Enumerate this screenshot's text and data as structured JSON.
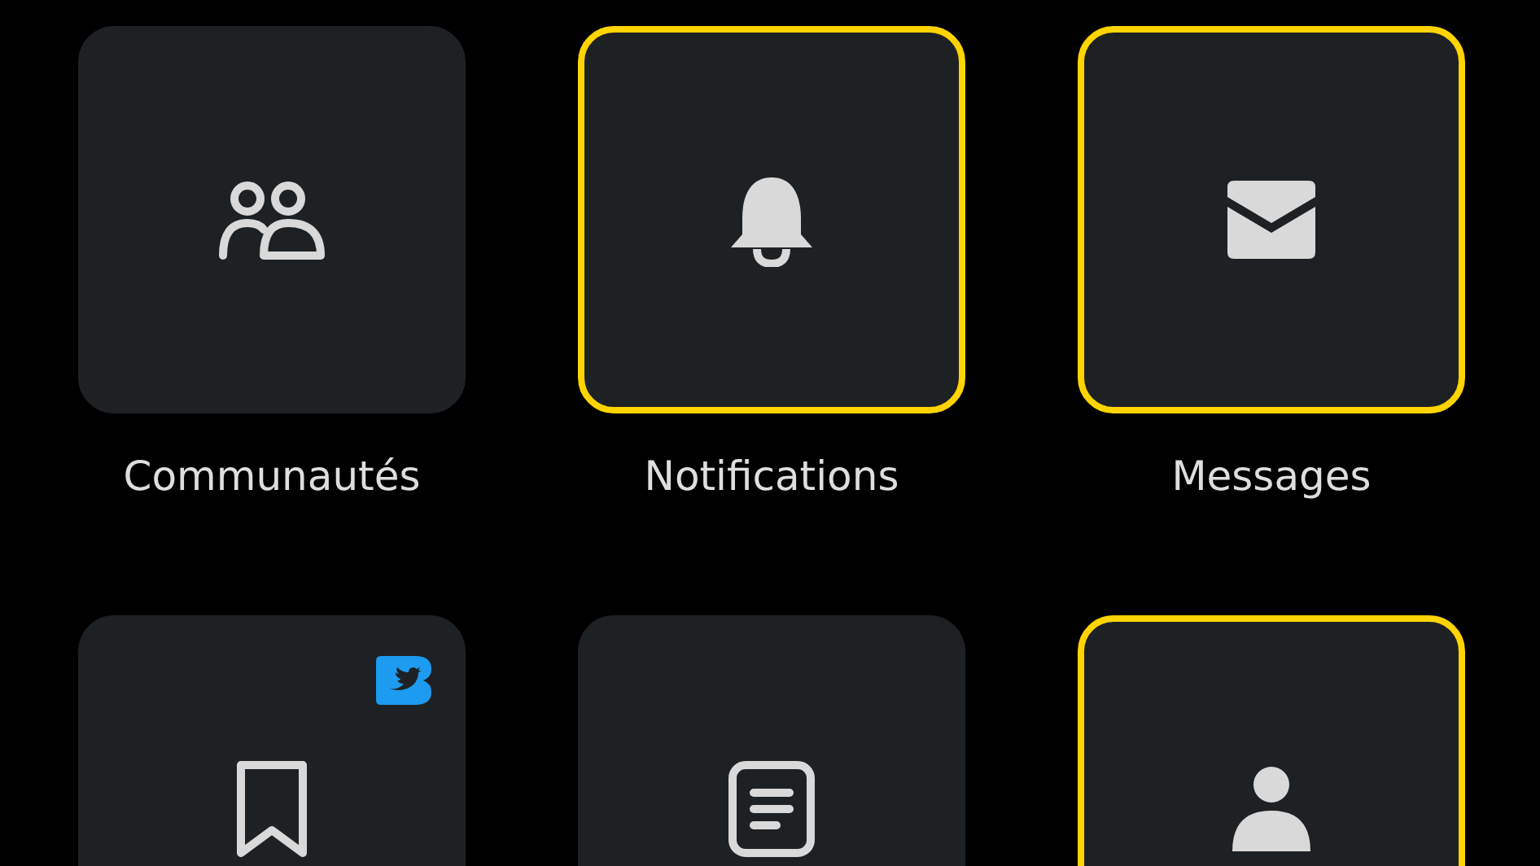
{
  "tiles": [
    {
      "label": "Communautés",
      "highlighted": false,
      "badge": false
    },
    {
      "label": "Notifications",
      "highlighted": true,
      "badge": false
    },
    {
      "label": "Messages",
      "highlighted": true,
      "badge": false
    },
    {
      "highlighted": false,
      "badge": true
    },
    {
      "highlighted": false,
      "badge": false
    },
    {
      "highlighted": true,
      "badge": false
    }
  ]
}
